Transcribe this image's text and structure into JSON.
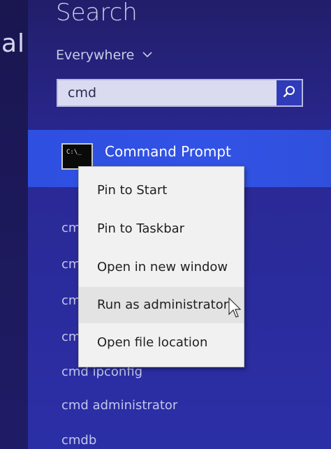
{
  "background_app": {
    "partial_text": "al"
  },
  "search_panel": {
    "title": "Search",
    "scope_label": "Everywhere",
    "scope_chevron_icon": "chevron-down-icon",
    "query_value": "cmd",
    "search_button_icon": "search-icon"
  },
  "selected_result": {
    "icon": "command-prompt-icon",
    "icon_text": "C:\\_",
    "name": "Command Prompt"
  },
  "results": [
    {
      "label": "cm"
    },
    {
      "label": "cm"
    },
    {
      "label": "cm"
    },
    {
      "label": "cm"
    },
    {
      "label": "cmd ipconfig"
    },
    {
      "label": "cmd administrator"
    },
    {
      "label": "cmdb"
    }
  ],
  "context_menu": {
    "items": [
      {
        "label": "Pin to Start"
      },
      {
        "label": "Pin to Taskbar"
      },
      {
        "label": "Open in new window"
      },
      {
        "label": "Run as administrator"
      },
      {
        "label": "Open file location"
      }
    ],
    "hovered_item": "Run as administrator"
  },
  "colors": {
    "selection_accent": "#3252e6",
    "panel_bg": "#2a2894",
    "menu_bg": "#f1f1f1"
  }
}
